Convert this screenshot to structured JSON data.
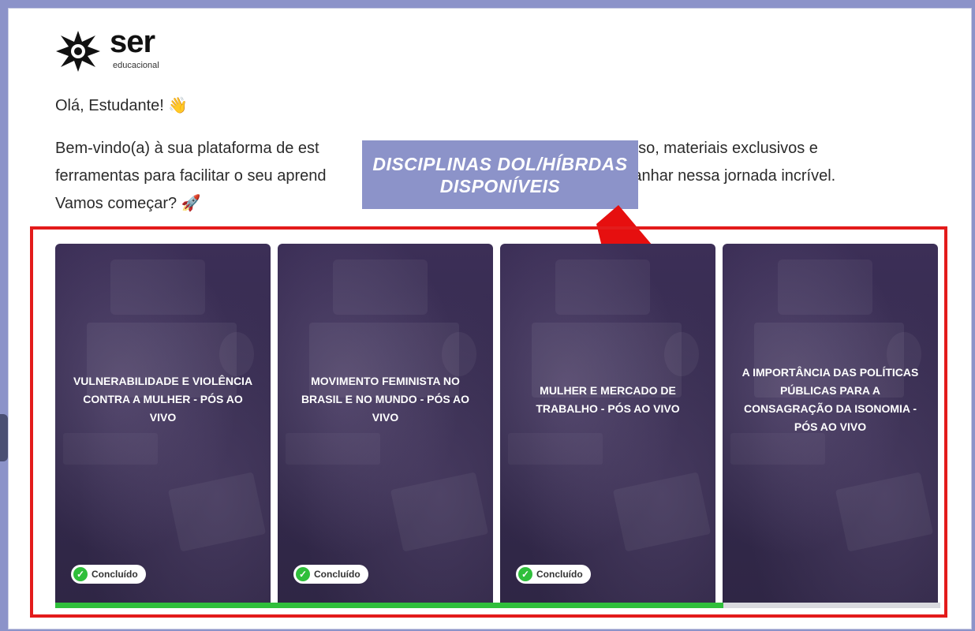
{
  "brand": {
    "name": "ser",
    "sub": "educacional"
  },
  "greeting": "Olá, Estudante! 👋",
  "intro_lines": [
    "Bem-vindo(a) à sua plataforma de est",
    "u curso, materiais exclusivos e",
    "ferramentas para facilitar o seu aprend",
    "ompanhar nessa jornada incrível.",
    "Vamos começar? 🚀"
  ],
  "callout": {
    "line1": "DISCIPLINAS DOL/HÍBRDAS",
    "line2": "DISPONÍVEIS"
  },
  "colors": {
    "accent": "#8c93c9",
    "highlight": "#e31b1b",
    "success": "#2fbf3b",
    "card": "#342a4d"
  },
  "courses": [
    {
      "title": "VULNERABILIDADE E VIOLÊNCIA CONTRA A MULHER - PÓS AO VIVO",
      "status": "Concluído"
    },
    {
      "title": "MOVIMENTO FEMINISTA NO BRASIL E NO MUNDO - PÓS AO VIVO",
      "status": "Concluído"
    },
    {
      "title": "MULHER E MERCADO DE TRABALHO - PÓS AO VIVO",
      "status": "Concluído"
    },
    {
      "title": "A IMPORTÂNCIA DAS POLÍTICAS PÚBLICAS PARA A CONSAGRAÇÃO DA ISONOMIA - PÓS AO VIVO",
      "status": ""
    }
  ],
  "progress": {
    "completed": 3,
    "total": 4,
    "fraction": 0.755
  },
  "icons": {
    "logo": "ser-star-logo",
    "badge": "check-circle-icon",
    "pointer": "red-arrow"
  }
}
